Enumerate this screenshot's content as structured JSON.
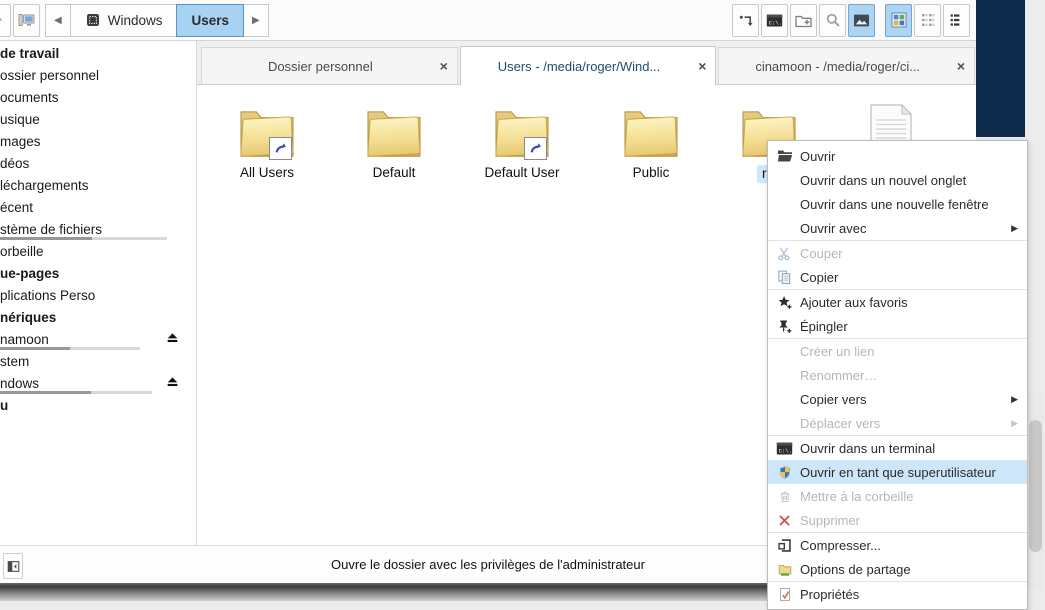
{
  "colors": {
    "accent_selection": "#a8d2f1",
    "menu_highlight": "#cde6fa",
    "active_tab_text": "#1d4e6e",
    "desktop_dark_panel": "#0f2b4c"
  },
  "toolbar": {
    "left_buttons": [
      {
        "id": "up",
        "icon": "up-arrow"
      },
      {
        "id": "computer",
        "icon": "computer"
      }
    ],
    "breadcrumb": {
      "back": "◀",
      "forward": "▶",
      "items": [
        {
          "id": "windows",
          "label": "Windows",
          "icon": "windows-device",
          "active": false
        },
        {
          "id": "users",
          "label": "Users",
          "active": true
        }
      ]
    },
    "right_buttons": [
      {
        "id": "enter-location",
        "icon": "goto",
        "active": false
      },
      {
        "id": "open-terminal",
        "icon": "terminal",
        "active": false
      },
      {
        "id": "new-folder",
        "icon": "new-folder",
        "active": false
      },
      {
        "id": "search",
        "icon": "search",
        "active": false
      },
      {
        "id": "show-thumbnails",
        "icon": "thumbnails",
        "active": true
      },
      {
        "id": "icon-view",
        "icon": "grid-view",
        "active": true,
        "group_start": true
      },
      {
        "id": "compact-view",
        "icon": "compact-view",
        "active": false
      },
      {
        "id": "list-view",
        "icon": "list-view",
        "active": false
      }
    ]
  },
  "tabs": [
    {
      "id": "home",
      "label": "Dossier personnel",
      "close": "×",
      "active": false
    },
    {
      "id": "users",
      "label": "Users - /media/roger/Wind...",
      "close": "×",
      "active": true
    },
    {
      "id": "cinamoon",
      "label": "cinamoon - /media/roger/ci...",
      "close": "×",
      "active": false
    }
  ],
  "sidebar": {
    "items": [
      {
        "id": "espace-travail",
        "label": "de travail",
        "bold": true
      },
      {
        "id": "dossier-personnel",
        "label": "ossier personnel"
      },
      {
        "id": "documents",
        "label": "ocuments"
      },
      {
        "id": "musique",
        "label": "usique"
      },
      {
        "id": "images",
        "label": "mages"
      },
      {
        "id": "videos",
        "label": "déos"
      },
      {
        "id": "telechargements",
        "label": "léchargements"
      },
      {
        "id": "recent",
        "label": "écent"
      },
      {
        "id": "systeme-fichiers",
        "label": "stème de fichiers",
        "usage": 0.55,
        "usage_width": 167
      },
      {
        "id": "corbeille",
        "label": "orbeille"
      },
      {
        "id": "marque-pages",
        "label": "ue-pages",
        "bold": true
      },
      {
        "id": "applications-perso",
        "label": "plications Perso"
      },
      {
        "id": "peripheriques",
        "label": "nériques",
        "bold": true
      },
      {
        "id": "cinamoon",
        "label": "namoon",
        "eject": true,
        "usage": 0.5,
        "usage_width": 140
      },
      {
        "id": "system",
        "label": "stem"
      },
      {
        "id": "windows",
        "label": "ndows",
        "eject": true,
        "usage": 0.6,
        "usage_width": 152
      },
      {
        "id": "reseau",
        "label": "u",
        "bold": true
      }
    ]
  },
  "files": [
    {
      "id": "all-users",
      "name": "All Users",
      "type": "folder",
      "shortcut": true,
      "selected": false
    },
    {
      "id": "default",
      "name": "Default",
      "type": "folder",
      "shortcut": false,
      "selected": false
    },
    {
      "id": "default-user",
      "name": "Default User",
      "type": "folder",
      "shortcut": true,
      "selected": false
    },
    {
      "id": "public",
      "name": "Public",
      "type": "folder",
      "shortcut": false,
      "selected": false
    },
    {
      "id": "roger",
      "name": "r",
      "type": "folder",
      "shortcut": false,
      "selected": true
    },
    {
      "id": "document",
      "name": "",
      "type": "document",
      "shortcut": false,
      "selected": false
    }
  ],
  "context_menu": {
    "items": [
      {
        "id": "open",
        "label": "Ouvrir",
        "icon": "folder-open",
        "disabled": false,
        "highlighted": false,
        "submenu": false,
        "sep_after": false
      },
      {
        "id": "open-new-tab",
        "label": "Ouvrir dans un nouvel onglet",
        "disabled": false,
        "highlighted": false,
        "submenu": false,
        "sep_after": false
      },
      {
        "id": "open-new-window",
        "label": "Ouvrir dans une nouvelle fenêtre",
        "disabled": false,
        "highlighted": false,
        "submenu": false,
        "sep_after": false
      },
      {
        "id": "open-with",
        "label": "Ouvrir avec",
        "disabled": false,
        "highlighted": false,
        "submenu": true,
        "sep_after": true
      },
      {
        "id": "cut",
        "label": "Couper",
        "icon": "scissors",
        "disabled": true,
        "highlighted": false,
        "submenu": false,
        "sep_after": false
      },
      {
        "id": "copy",
        "label": "Copier",
        "icon": "copy",
        "disabled": false,
        "highlighted": false,
        "submenu": false,
        "sep_after": true
      },
      {
        "id": "add-favorites",
        "label": "Ajouter aux favoris",
        "icon": "star-plus",
        "disabled": false,
        "highlighted": false,
        "submenu": false,
        "sep_after": false
      },
      {
        "id": "pin",
        "label": "Épingler",
        "icon": "pin-plus",
        "disabled": false,
        "highlighted": false,
        "submenu": false,
        "sep_after": true
      },
      {
        "id": "create-link",
        "label": "Créer un lien",
        "disabled": true,
        "highlighted": false,
        "submenu": false,
        "sep_after": false
      },
      {
        "id": "rename",
        "label": "Renommer…",
        "disabled": true,
        "highlighted": false,
        "submenu": false,
        "sep_after": false
      },
      {
        "id": "copy-to",
        "label": "Copier vers",
        "disabled": false,
        "highlighted": false,
        "submenu": true,
        "sep_after": false
      },
      {
        "id": "move-to",
        "label": "Déplacer vers",
        "disabled": true,
        "highlighted": false,
        "submenu": true,
        "sep_after": true
      },
      {
        "id": "open-in-terminal",
        "label": "Ouvrir dans un terminal",
        "icon": "terminal",
        "disabled": false,
        "highlighted": false,
        "submenu": false,
        "sep_after": false
      },
      {
        "id": "open-as-root",
        "label": "Ouvrir en tant que superutilisateur",
        "icon": "shield",
        "disabled": false,
        "highlighted": true,
        "submenu": false,
        "sep_after": false
      },
      {
        "id": "move-to-trash",
        "label": "Mettre à la corbeille",
        "icon": "trash",
        "disabled": true,
        "highlighted": false,
        "submenu": false,
        "sep_after": false
      },
      {
        "id": "delete",
        "label": "Supprimer",
        "icon": "delete-x",
        "disabled": true,
        "highlighted": false,
        "submenu": false,
        "sep_after": true
      },
      {
        "id": "compress",
        "label": "Compresser...",
        "icon": "compress",
        "disabled": false,
        "highlighted": false,
        "submenu": false,
        "sep_after": false
      },
      {
        "id": "sharing-options",
        "label": "Options de partage",
        "icon": "share",
        "disabled": false,
        "highlighted": false,
        "submenu": false,
        "sep_after": true
      },
      {
        "id": "properties",
        "label": "Propriétés",
        "icon": "properties",
        "disabled": false,
        "highlighted": false,
        "submenu": false,
        "sep_after": false
      }
    ]
  },
  "statusbar": {
    "text": "Ouvre le dossier avec les privilèges de l'administrateur"
  }
}
